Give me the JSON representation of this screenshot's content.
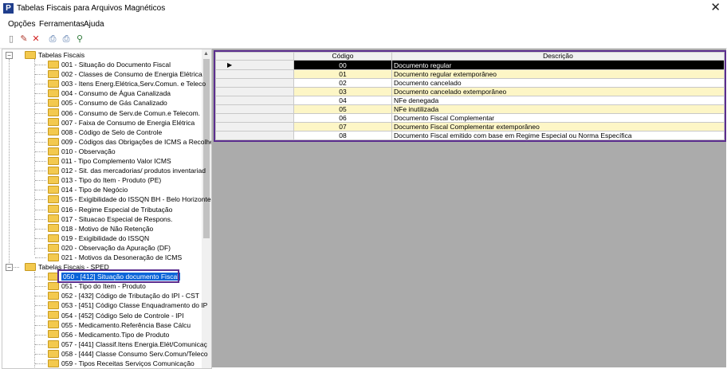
{
  "window": {
    "title": "Tabelas Fiscais para Arquivos Magnéticos",
    "app_icon": "P"
  },
  "menu": [
    "Opções",
    "Ferramentas",
    "Ajuda"
  ],
  "toolbar": [
    "new-icon",
    "edit-icon",
    "delete-icon",
    "print-icon",
    "print-preview-icon",
    "search-icon"
  ],
  "tree": {
    "root1": "Tabelas Fiscais",
    "items1": [
      "001 - Situação do Documento Fiscal",
      "002 - Classes de Consumo de Energia Elétrica",
      "003 - Itens Energ.Elétrica,Serv.Comun. e Teleco",
      "004 - Consumo de Água Canalizada",
      "005 - Consumo de Gás Canalizado",
      "006 - Consumo de Serv.de Comun.e Telecom.",
      "007 - Faixa de Consumo de Energia Elétrica",
      "008 - Código de Selo de Controle",
      "009 - Códigos das Obrigações de ICMS a Recolhe",
      "010 - Observação",
      "011 - Tipo Complemento Valor ICMS",
      "012 - Sit. das mercadorias/ produtos inventariad",
      "013 - Tipo do Item - Produto (PE)",
      "014 - Tipo de Negócio",
      "015 - Exigibilidade do ISSQN BH - Belo Horizonte",
      "016 - Regime Especial de Tributação",
      "017 - Situacao Especial de Respons.",
      "018 - Motivo de Não Retenção",
      "019 - Exigibilidade do ISSQN",
      "020 - Observação da Apuração (DF)",
      "021 - Motivos da Desoneração de ICMS"
    ],
    "root2": "Tabelas Fiscais - SPED",
    "items2": [
      "050 - [412] Situação documento Fiscal",
      "051 -          Tipo do Item - Produto",
      "052 - [432] Código de Tributação do IPI - CST",
      "053 - [451] Código Classe Enquadramento do IP",
      "054 - [452] Código Selo de Controle - IPI",
      "055 -          Medicamento.Referência Base Cálcu",
      "056 -          Medicamento.Tipo de Produto",
      "057 - [441] Classif.Itens Energia.Elét/Comunicaç",
      "058 - [444] Classe Consumo Serv.Comun/Teleco",
      "059 -          Tipos Receitas Serviços Comunicação"
    ]
  },
  "grid": {
    "headers": {
      "code": "Código",
      "desc": "Descrição"
    },
    "rows": [
      {
        "code": "00",
        "desc": "Documento regular"
      },
      {
        "code": "01",
        "desc": "Documento regular extemporâneo"
      },
      {
        "code": "02",
        "desc": "Documento cancelado"
      },
      {
        "code": "03",
        "desc": "Documento cancelado extemporâneo"
      },
      {
        "code": "04",
        "desc": "NFe denegada"
      },
      {
        "code": "05",
        "desc": "NFe inutilizada"
      },
      {
        "code": "06",
        "desc": "Documento Fiscal Complementar"
      },
      {
        "code": "07",
        "desc": "Documento Fiscal Complementar extemporâneo"
      },
      {
        "code": "08",
        "desc": "Documento Fiscal emitido com base em Regime Especial ou Norma Específica"
      }
    ]
  }
}
